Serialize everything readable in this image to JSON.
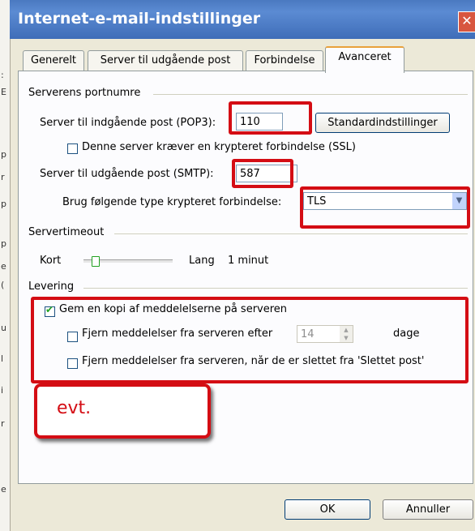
{
  "window": {
    "title": "Internet-e-mail-indstillinger",
    "close_glyph": "✕"
  },
  "background_strip": [
    ":",
    "E",
    "p",
    "r",
    "p",
    "p",
    "e",
    "(",
    "u",
    "l",
    "i",
    "r",
    "e"
  ],
  "tabs": [
    {
      "label": "Generelt"
    },
    {
      "label": "Server til udgående post"
    },
    {
      "label": "Forbindelse"
    },
    {
      "label": "Avanceret"
    }
  ],
  "ports": {
    "group_label": "Serverens portnumre",
    "incoming_label": "Server til indgående post (POP3):",
    "incoming_value": "110",
    "defaults_button": "Standardindstillinger",
    "ssl_checkbox": "Denne server kræver en krypteret forbindelse (SSL)",
    "outgoing_label": "Server til udgående post (SMTP):",
    "outgoing_value": "587",
    "encryption_label": "Brug følgende type krypteret forbindelse:",
    "encryption_value": "TLS"
  },
  "timeout": {
    "group_label": "Servertimeout",
    "short_label": "Kort",
    "long_label": "Lang",
    "value_label": "1 minut",
    "level": 0.1
  },
  "delivery": {
    "group_label": "Levering",
    "keep_copy": "Gem en kopi af meddelelserne på serveren",
    "keep_copy_checked": true,
    "remove_after": "Fjern meddelelser fra serveren efter",
    "remove_after_checked": false,
    "days_value": "14",
    "days_label": "dage",
    "remove_deleted": "Fjern meddelelser fra serveren, når de er slettet fra 'Slettet post'",
    "remove_deleted_checked": false
  },
  "annotation": {
    "text": "evt."
  },
  "footer": {
    "ok": "OK",
    "cancel": "Annuller"
  },
  "colors": {
    "title_bar": "#4a79c0",
    "highlight": "#d40d14",
    "tab_accent": "#e9a13b"
  }
}
